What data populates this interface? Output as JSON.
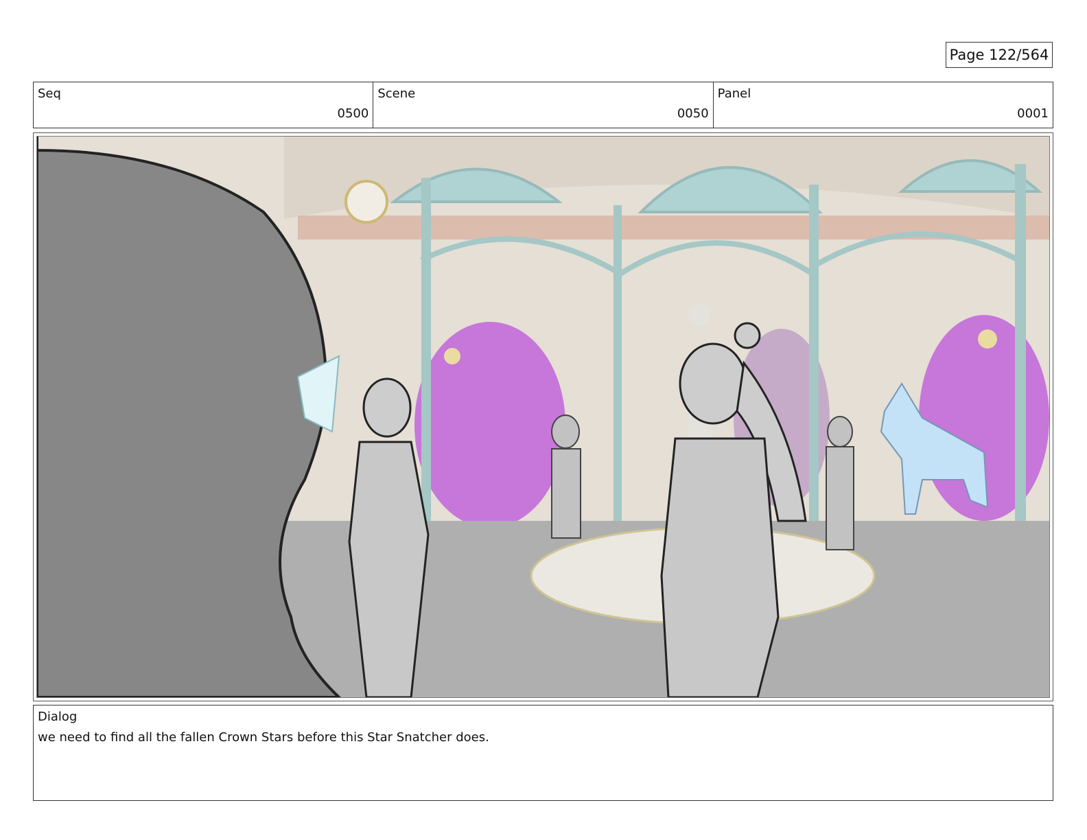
{
  "page": {
    "label": "Page 122/564"
  },
  "header": {
    "seq": {
      "label": "Seq",
      "value": "0500"
    },
    "scene": {
      "label": "Scene",
      "value": "0050"
    },
    "panel": {
      "label": "Panel",
      "value": "0001"
    }
  },
  "dialog": {
    "label": "Dialog",
    "text": "we need to find all the fallen Crown Stars before this Star Snatcher does."
  },
  "colors": {
    "wall": "#e3ddd2",
    "teal": "#9ec3c1",
    "magenta": "#c36bd6",
    "floor": "#a9a9a9",
    "sketch_gray": "#808080",
    "unicorn_blue": "#bfe0f7"
  }
}
